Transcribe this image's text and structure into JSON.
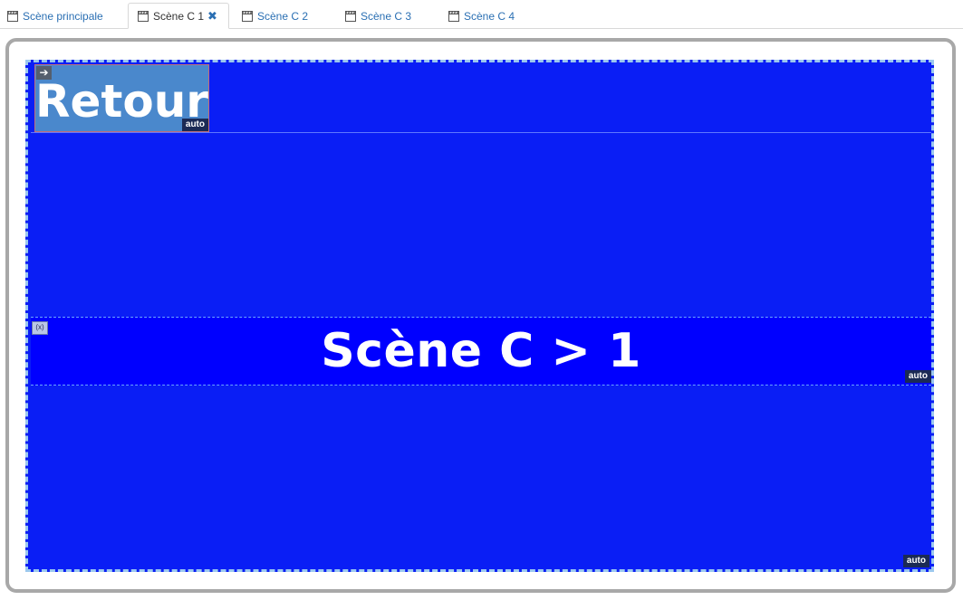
{
  "tabs": [
    {
      "label": "Scène principale",
      "icon": "scene-icon",
      "active": false
    },
    {
      "label": "Scène C 1",
      "icon": "scene-icon",
      "active": true,
      "closable": true
    },
    {
      "label": "Scène C 2",
      "icon": "scene-icon",
      "active": false
    },
    {
      "label": "Scène C 3",
      "icon": "scene-icon",
      "active": false
    },
    {
      "label": "Scène C 4",
      "icon": "scene-icon",
      "active": false
    }
  ],
  "stage": {
    "retour_label": "Retour",
    "title": "Scène C > 1",
    "auto_label": "auto",
    "colors": {
      "background": "#0a1ef5",
      "title_band": "#0000ff",
      "retour_button": "#4a88cc"
    }
  }
}
